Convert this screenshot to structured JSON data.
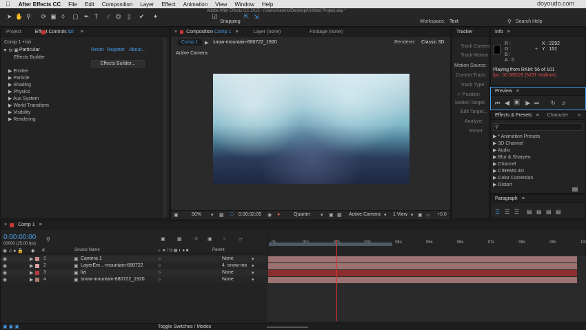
{
  "menubar": {
    "apple": "",
    "items": [
      "After Effects CC",
      "File",
      "Edit",
      "Composition",
      "Layer",
      "Effect",
      "Animation",
      "View",
      "Window",
      "Help"
    ]
  },
  "toolbar": {
    "title": "Adobe After Effects CC 2015 - /Users/xiaomo/Desktop/Untitled Project.aep *",
    "snapping": "Snapping",
    "workspace_label": "Workspace:",
    "workspace_value": "Text",
    "search_help": "Search Help"
  },
  "watermark": "doyoudo.com",
  "project_panel": {
    "tab_project": "Project",
    "tab_effect_controls": "Effect Controls",
    "tab_layer": "lizi",
    "breadcrumb": "Comp 1 • lizi",
    "effect_name": "Particular",
    "reset": "Reset",
    "register": "Register",
    "about": "About...",
    "effects_builder_label": "Effects Builder",
    "effects_builder_button": "Effects Builder...",
    "groups": [
      "Emitter",
      "Particle",
      "Shading",
      "Physics",
      "Aux System",
      "World Transform",
      "Visibility",
      "Rendering"
    ]
  },
  "composition_panel": {
    "tab_composition": "Composition",
    "tab_comp_name": "Comp 1",
    "tab_layer": "Layer (none)",
    "tab_footage": "Footage (none)",
    "subtab_comp": "Comp 1",
    "subtab_footage": "snow-mountain-680722_1920",
    "renderer_label": "Renderer:",
    "renderer_value": "Classic 3D",
    "active_camera": "Active Camera",
    "footer": {
      "zoom": "50%",
      "timecode": "0:00:02:05",
      "resolution": "Quarter",
      "view": "Active Camera",
      "views": "1 View",
      "plus": "+0.0"
    }
  },
  "tracker_panel": {
    "tab": "Tracker",
    "items": [
      "Track Camera",
      "Track Motion",
      "Motion Source:",
      "Current Track:",
      "Track Type:",
      "Position",
      "Motion Target:",
      "Edit Target...",
      "Analyze:",
      "Reset"
    ]
  },
  "info_panel": {
    "tab": "Info",
    "r": "R :",
    "g": "G :",
    "b": "B :",
    "a": "A : 0",
    "x": "X : 2292",
    "y": "Y : 152",
    "playing": "Playing from RAM: 56 of 101",
    "fps": "fps: 00.566/25 (NOT realtime)"
  },
  "preview_panel": {
    "tab": "Preview"
  },
  "effects_presets_panel": {
    "tab": "Effects & Presets",
    "tab_character": "Character",
    "search_placeholder": "",
    "items": [
      "* Animation Presets",
      "3D Channel",
      "Audio",
      "Blur & Sharpen",
      "Channel",
      "CINEMA 4D",
      "Color Correction",
      "Distort"
    ]
  },
  "paragraph_panel": {
    "tab": "Paragraph"
  },
  "timeline": {
    "tab": "Comp 1",
    "timecode": "0:00:00:00",
    "timecode_sub": "00000 (25.00 fps)",
    "col_number": "#",
    "col_source": "Source Name",
    "col_parent": "Parent",
    "ruler": [
      "0s",
      "01s",
      "02s",
      "03s",
      "04s",
      "05s",
      "06s",
      "07s",
      "08s",
      "09s",
      "10s"
    ],
    "playhead_seconds": 2.2,
    "work_area_end_seconds": 4.0,
    "layers": [
      {
        "num": "1",
        "name": "Camera 1",
        "parent": "None",
        "color": "#c88c8c"
      },
      {
        "num": "2",
        "name": "LayerEm...-mountain-680722",
        "parent": "4. snow-mo",
        "color": "#d9a0a0"
      },
      {
        "num": "3",
        "name": "lizi",
        "parent": "None",
        "color": "#b83a3a"
      },
      {
        "num": "4",
        "name": "snow-mountain-680722_1920",
        "parent": "None",
        "color": "#a67c6c"
      }
    ],
    "toggle_label": "Toggle Switches / Modes"
  },
  "colors": {
    "accent_blue": "#4a9ee8",
    "warning_red": "#e04a4a",
    "layer_bar_pink": "#9c7272",
    "layer_bar_red": "#8c2e2e"
  }
}
